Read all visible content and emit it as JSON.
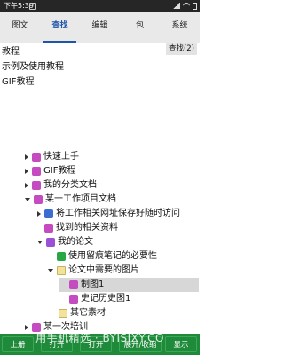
{
  "status": {
    "time": "下午5:39"
  },
  "tabs": [
    {
      "label": "图文"
    },
    {
      "label": "查找"
    },
    {
      "label": "编辑"
    },
    {
      "label": "包"
    },
    {
      "label": "系统"
    }
  ],
  "doc": {
    "lines": [
      "教程",
      "示例及使用教程",
      "GIF教程"
    ],
    "find_button": "查找(2)"
  },
  "tree": [
    {
      "label": "快速上手"
    },
    {
      "label": "GIF教程"
    },
    {
      "label": "我的分类文档"
    },
    {
      "label": "某一工作项目文档"
    },
    {
      "label": "将工作相关网址保存好随时访问"
    },
    {
      "label": "找到的相关资料"
    },
    {
      "label": "我的论文"
    },
    {
      "label": "使用留痕笔记的必要性"
    },
    {
      "label": "论文中需要的图片"
    },
    {
      "label": "制图1"
    },
    {
      "label": "史记历史图1"
    },
    {
      "label": "其它素材"
    },
    {
      "label": "某一次培训"
    }
  ],
  "toolbar": {
    "buttons": [
      "上册",
      "打开",
      "打开",
      "展开/收缩",
      "显示"
    ]
  },
  "watermark": "用手机精选 · BYISIXY.CO",
  "colors": {
    "accent": "#1d55a8",
    "toolbar": "#1f8a3a"
  }
}
